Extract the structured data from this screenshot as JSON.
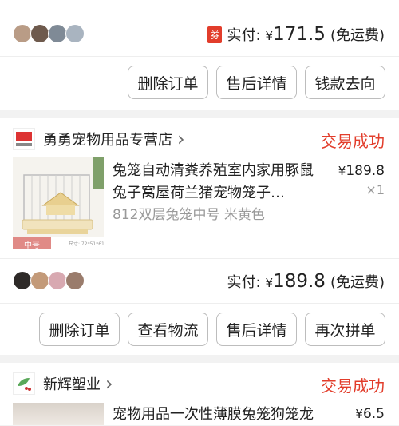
{
  "order1": {
    "paid_label": "实付:",
    "coupon_badge": "券",
    "currency": "¥",
    "paid_amount": "171.5",
    "shipping_note": "(免运费)",
    "buttons": {
      "delete": "删除订单",
      "after_sales": "售后详情",
      "refund_trace": "钱款去向"
    }
  },
  "order2": {
    "shop": {
      "name": "勇勇宠物用品专营店",
      "chevron": "›"
    },
    "status": "交易成功",
    "item": {
      "title": "兔笼自动清粪养殖室内家用豚鼠兔子窝屋荷兰猪宠物笼子…",
      "variant": "812双层兔笼中号 米黄色",
      "currency": "¥",
      "price": "189.8",
      "qty": "×1",
      "thumb_tag": "中号"
    },
    "paid_label": "实付:",
    "currency": "¥",
    "paid_amount": "189.8",
    "shipping_note": "(免运费)",
    "buttons": {
      "delete": "删除订单",
      "logistics": "查看物流",
      "after_sales": "售后详情",
      "group_again": "再次拼单"
    }
  },
  "order3": {
    "shop": {
      "name": "新辉塑业",
      "chevron": "›"
    },
    "status": "交易成功",
    "item": {
      "title": "宠物用品一次性薄膜兔笼狗笼龙",
      "currency": "¥",
      "price": "6.5"
    }
  },
  "colors": {
    "accent": "#e23d2b",
    "background": "#f2f2f2",
    "border": "#bdbdbd"
  }
}
